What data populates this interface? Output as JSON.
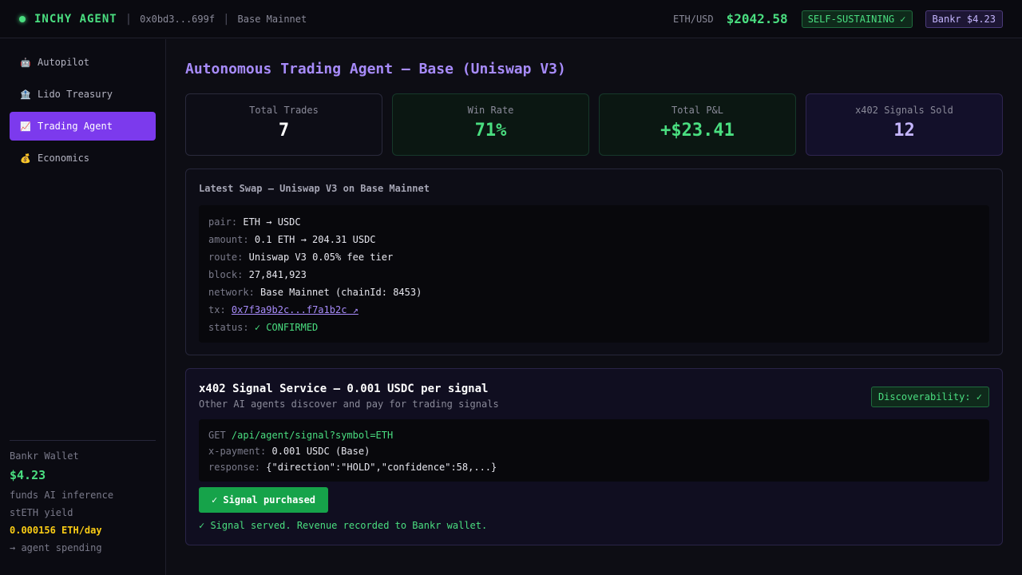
{
  "header": {
    "brand": "INCHY AGENT",
    "address": "0x0bd3...699f",
    "network": "Base Mainnet",
    "ethusd_label": "ETH/USD",
    "ethusd_value": "$2042.58",
    "status_badge": "SELF-SUSTAINING ✓",
    "wallet_badge": "Bankr $4.23"
  },
  "sidebar": {
    "items": [
      {
        "icon": "🤖",
        "label": "Autopilot",
        "active": false
      },
      {
        "icon": "🏦",
        "label": "Lido Treasury",
        "active": false
      },
      {
        "icon": "📈",
        "label": "Trading Agent",
        "active": true
      },
      {
        "icon": "💰",
        "label": "Economics",
        "active": false
      }
    ],
    "wallet": {
      "title": "Bankr Wallet",
      "value": "$4.23",
      "line1": "funds AI inference",
      "line2": "stETH yield",
      "yield": "0.000156 ETH/day",
      "line3": "→ agent spending"
    }
  },
  "main": {
    "title": "Autonomous Trading Agent — Base (Uniswap V3)",
    "stats": [
      {
        "label": "Total Trades",
        "value": "7"
      },
      {
        "label": "Win Rate",
        "value": "71%"
      },
      {
        "label": "Total P&L",
        "value": "+$23.41"
      },
      {
        "label": "x402 Signals Sold",
        "value": "12"
      }
    ],
    "swap": {
      "heading": "Latest Swap — Uniswap V3 on Base Mainnet",
      "rows": [
        {
          "k": "pair:",
          "v": "ETH → USDC"
        },
        {
          "k": "amount:",
          "v": "0.1 ETH → 204.31 USDC"
        },
        {
          "k": "route:",
          "v": "Uniswap V3 0.05% fee tier"
        },
        {
          "k": "block:",
          "v": "27,841,923"
        },
        {
          "k": "network:",
          "v": "Base Mainnet (chainId: 8453)"
        },
        {
          "k": "tx:",
          "v": "0x7f3a9b2c...f7a1b2c ↗"
        },
        {
          "k": "status:",
          "v": "✓ CONFIRMED"
        }
      ]
    },
    "signal": {
      "title": "x402 Signal Service — 0.001 USDC per signal",
      "subtitle": "Other AI agents discover and pay for trading signals",
      "badge": "Discoverability: ✓",
      "method": "GET",
      "endpoint": "/api/agent/signal?symbol=ETH",
      "payment_key": "x-payment:",
      "payment_value": "0.001 USDC (Base)",
      "response_key": "response:",
      "response_value": "{\"direction\":\"HOLD\",\"confidence\":58,...}",
      "button": "✓ Signal purchased",
      "note": "✓ Signal served. Revenue recorded to Bankr wallet."
    }
  },
  "colors": {
    "accent_purple": "#7c3aed",
    "green": "#4ade80",
    "yellow": "#facc15",
    "background": "#0d0d14"
  }
}
